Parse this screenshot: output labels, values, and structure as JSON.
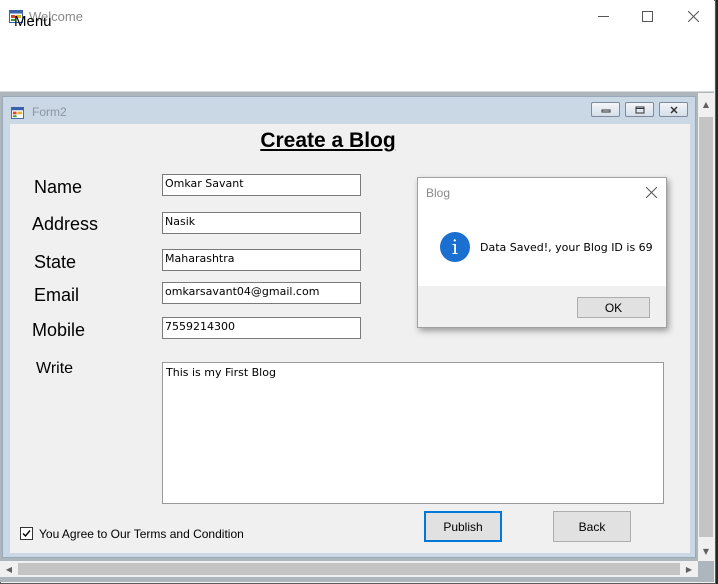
{
  "window": {
    "title": "Welcome"
  },
  "menubar": {
    "menu_label": "Menu"
  },
  "child_window": {
    "title": "Form2"
  },
  "form": {
    "heading": "Create a Blog",
    "labels": {
      "name": "Name",
      "address": "Address",
      "state": "State",
      "email": "Email",
      "mobile": "Mobile",
      "write": "Write"
    },
    "values": {
      "name": "Omkar Savant",
      "address": "Nasik",
      "state": "Maharashtra",
      "email": "omkarsavant04@gmail.com",
      "mobile": "7559214300",
      "write": "This is my First Blog"
    },
    "terms_checked": true,
    "terms_label": "You Agree to Our Terms and Condition",
    "publish_label": "Publish",
    "back_label": "Back"
  },
  "message_box": {
    "title": "Blog",
    "icon": "info-icon",
    "text": "Data Saved!, your Blog ID is 69",
    "ok_label": "OK"
  },
  "colors": {
    "accent": "#0078d7",
    "info_icon": "#1a6fd1",
    "mdi_caption": "#cad7e5"
  }
}
